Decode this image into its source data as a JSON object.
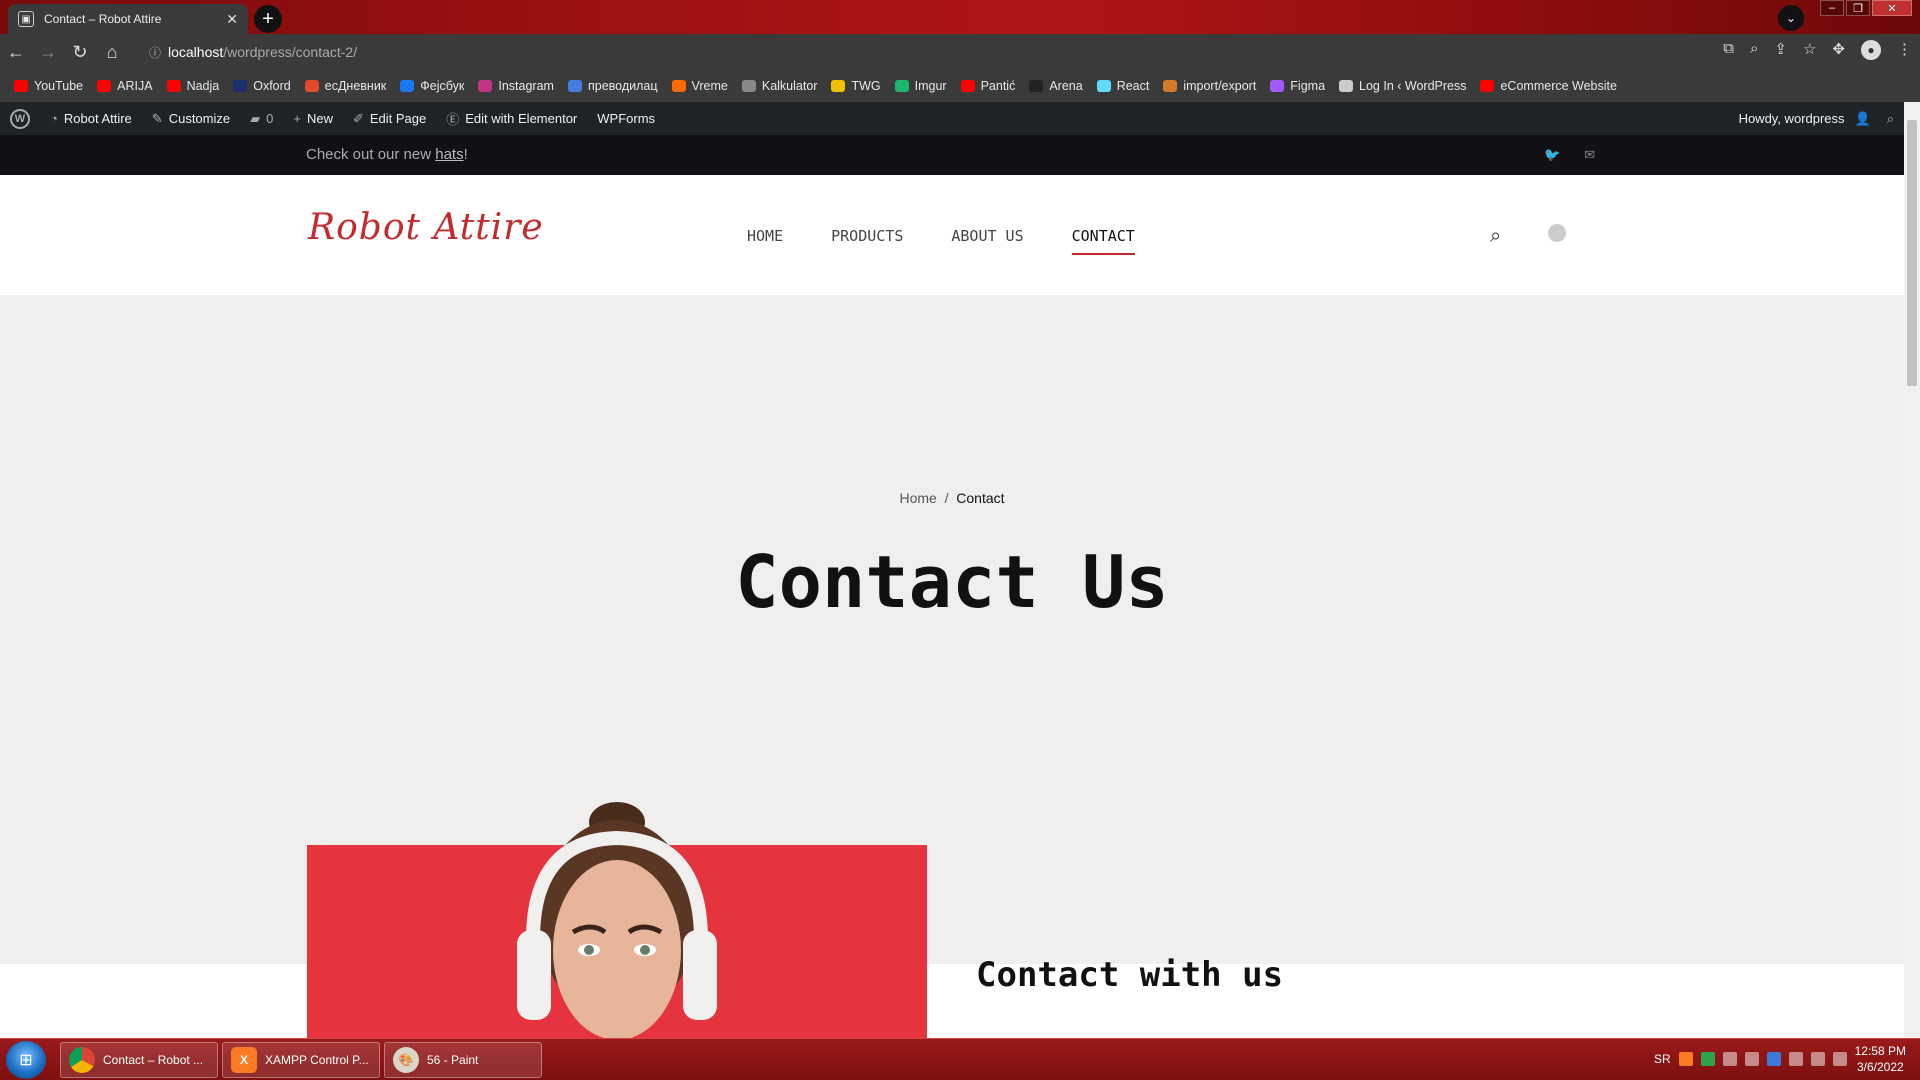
{
  "browser": {
    "tab_title": "Contact – Robot Attire",
    "url_host": "localhost",
    "url_path": "/wordpress/contact-2/"
  },
  "bookmarks": [
    {
      "label": "YouTube",
      "color": "#ff0000"
    },
    {
      "label": "ARIJA",
      "color": "#ff0000"
    },
    {
      "label": "Nadja",
      "color": "#ff0000"
    },
    {
      "label": "Oxford",
      "color": "#1a2f6b"
    },
    {
      "label": "есДневник",
      "color": "#e24a2b"
    },
    {
      "label": "Фејсбук",
      "color": "#1877f2"
    },
    {
      "label": "Instagram",
      "color": "#c13584"
    },
    {
      "label": "преводилац",
      "color": "#4a7be0"
    },
    {
      "label": "Vreme",
      "color": "#ff6a00"
    },
    {
      "label": "Kalkulator",
      "color": "#888888"
    },
    {
      "label": "TWG",
      "color": "#f2c200"
    },
    {
      "label": "Imgur",
      "color": "#1bb76e"
    },
    {
      "label": "Pantić",
      "color": "#ff0000"
    },
    {
      "label": "Arena",
      "color": "#222222"
    },
    {
      "label": "React",
      "color": "#61dafb"
    },
    {
      "label": "import/export",
      "color": "#d07a2a"
    },
    {
      "label": "Figma",
      "color": "#a259ff"
    },
    {
      "label": "Log In ‹ WordPress",
      "color": "#cccccc"
    },
    {
      "label": "eCommerce Website",
      "color": "#ff0000"
    }
  ],
  "wpbar": {
    "site_name": "Robot Attire",
    "customize": "Customize",
    "comments": "0",
    "new": "New",
    "edit_page": "Edit Page",
    "elementor": "Edit with Elementor",
    "wpforms": "WPForms",
    "howdy": "Howdy, wordpress"
  },
  "announcement": {
    "prefix": "Check out our new ",
    "link": "hats",
    "suffix": "!"
  },
  "header": {
    "logo": "Robot Attire",
    "nav": [
      "HOME",
      "PRODUCTS",
      "ABOUT US",
      "CONTACT"
    ],
    "active_nav": "CONTACT"
  },
  "hero": {
    "breadcrumb_home": "Home",
    "breadcrumb_sep": "/",
    "breadcrumb_current": "Contact",
    "title": "Contact Us"
  },
  "section": {
    "heading": "Contact with us"
  },
  "taskbar": {
    "items": [
      "Contact – Robot ...",
      "XAMPP Control P...",
      "56 - Paint"
    ],
    "lang": "SR",
    "time": "12:58 PM",
    "date": "3/6/2022"
  },
  "colors": {
    "accent": "#c22a2e",
    "photo_bg": "#e6343e",
    "wpbar_bg": "#1e2327",
    "topbar_bg": "#111015"
  }
}
